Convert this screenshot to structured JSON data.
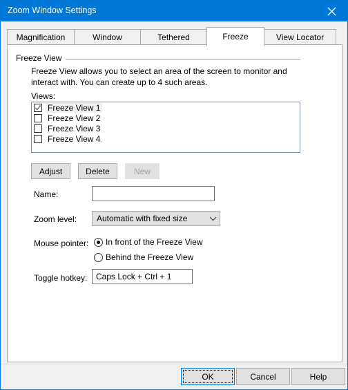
{
  "window": {
    "title": "Zoom Window Settings",
    "close_icon": "close-icon",
    "accent_color": "#0078d7",
    "titlebar_color": "#0078d7",
    "face_color": "#f0f0f0"
  },
  "tabs": [
    {
      "label": "Magnification",
      "active": false
    },
    {
      "label": "Window",
      "active": false
    },
    {
      "label": "Tethered",
      "active": false
    },
    {
      "label": "Freeze",
      "active": true
    },
    {
      "label": "View Locator",
      "active": false
    }
  ],
  "group": {
    "legend": "Freeze View",
    "description": "Freeze View allows you to select an area of the screen to monitor and interact with. You can create up to 4 such areas.",
    "views_label": "Views:"
  },
  "views_list": [
    {
      "label": "Freeze View 1",
      "checked": true,
      "selected": true
    },
    {
      "label": "Freeze View 2",
      "checked": false,
      "selected": false
    },
    {
      "label": "Freeze View 3",
      "checked": false,
      "selected": false
    },
    {
      "label": "Freeze View 4",
      "checked": false,
      "selected": false
    }
  ],
  "list_buttons": {
    "adjust": "Adjust",
    "delete": "Delete",
    "new": "New",
    "new_disabled": true
  },
  "fields": {
    "name_label": "Name:",
    "name_value": "",
    "name_placeholder": "",
    "zoom_level_label": "Zoom level:",
    "zoom_level_value": "Automatic with fixed size",
    "mouse_pointer_label": "Mouse pointer:",
    "mouse_pointer_options": [
      {
        "label": "In front of the Freeze View",
        "selected": true
      },
      {
        "label": "Behind the Freeze View",
        "selected": false
      }
    ],
    "toggle_hotkey_label": "Toggle hotkey:",
    "toggle_hotkey_value": "Caps Lock + Ctrl + 1"
  },
  "footer": {
    "ok": "OK",
    "cancel": "Cancel",
    "help": "Help"
  }
}
